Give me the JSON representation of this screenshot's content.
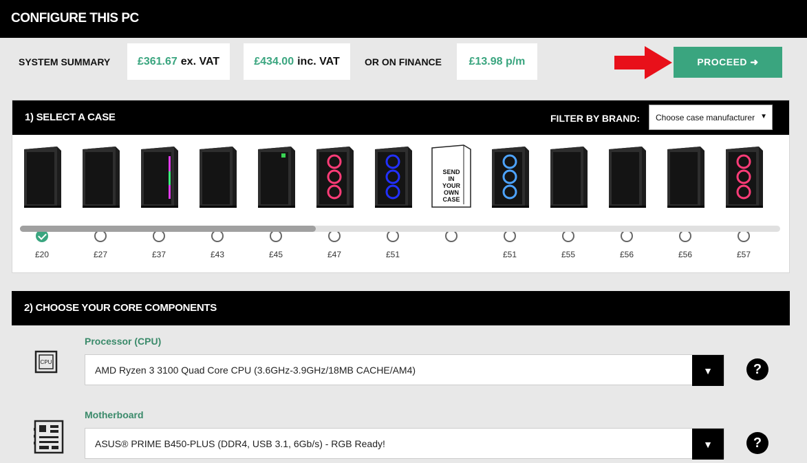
{
  "page_title": "CONFIGURE THIS PC",
  "summary": {
    "label": "SYSTEM SUMMARY",
    "ex_vat_amount": "£361.67",
    "ex_vat_label": "ex. VAT",
    "inc_vat_amount": "£434.00",
    "inc_vat_label": "inc. VAT",
    "finance_label": "OR ON FINANCE",
    "finance_amount": "£13.98 p/m",
    "proceed_label": "PROCEED ➜"
  },
  "case_section": {
    "title": "1) SELECT A CASE",
    "filter_label": "FILTER BY BRAND:",
    "filter_value": "Choose case manufacturer",
    "cases": [
      {
        "price": "£20",
        "selected": true
      },
      {
        "price": "£27"
      },
      {
        "price": "£37"
      },
      {
        "price": "£43"
      },
      {
        "price": "£45"
      },
      {
        "price": "£47"
      },
      {
        "price": "£51"
      },
      {
        "price": "",
        "label": "SEND IN YOUR OWN CASE"
      },
      {
        "price": "£51"
      },
      {
        "price": "£55"
      },
      {
        "price": "£56"
      },
      {
        "price": "£56"
      },
      {
        "price": "£57"
      }
    ]
  },
  "components_section": {
    "title": "2) CHOOSE YOUR CORE COMPONENTS",
    "items": [
      {
        "label": "Processor (CPU)",
        "value": "AMD Ryzen 3 3100 Quad Core CPU (3.6GHz-3.9GHz/18MB CACHE/AM4)",
        "icon": "cpu-icon",
        "icon_text": "CPU"
      },
      {
        "label": "Motherboard",
        "value": "ASUS® PRIME B450-PLUS (DDR4, USB 3.1, 6Gb/s) - RGB Ready!",
        "icon": "motherboard-icon"
      }
    ]
  },
  "colors": {
    "accent": "#3aa57f",
    "arrow": "#e8101a"
  }
}
